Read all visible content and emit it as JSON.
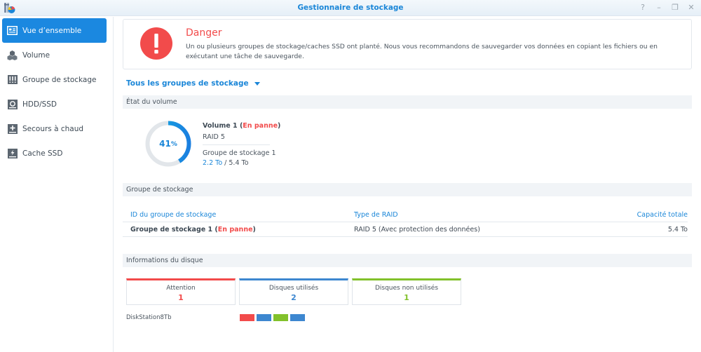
{
  "window": {
    "title": "Gestionnaire de stockage",
    "controls": [
      {
        "name": "help",
        "glyph": "?"
      },
      {
        "name": "minimize",
        "glyph": "–"
      },
      {
        "name": "restore",
        "glyph": "❐"
      },
      {
        "name": "close",
        "glyph": "✕"
      }
    ]
  },
  "sidebar": {
    "items": [
      {
        "label": "Vue d’ensemble",
        "icon": "overview-icon",
        "active": true
      },
      {
        "label": "Volume",
        "icon": "volume-icon",
        "active": false
      },
      {
        "label": "Groupe de stockage",
        "icon": "storage-pool-icon",
        "active": false
      },
      {
        "label": "HDD/SSD",
        "icon": "hdd-icon",
        "active": false
      },
      {
        "label": "Secours à chaud",
        "icon": "hot-spare-icon",
        "active": false
      },
      {
        "label": "Cache SSD",
        "icon": "ssd-cache-icon",
        "active": false
      }
    ]
  },
  "alert": {
    "title": "Danger",
    "message": "Un ou plusieurs groupes de stockage/caches SSD ont planté. Nous vous recommandons de sauvegarder vos données en copiant les fichiers ou en exécutant une tâche de sauvegarde."
  },
  "filter": {
    "selected": "Tous les groupes de stockage"
  },
  "volume_status": {
    "heading": "État du volume",
    "usage_percent": 41,
    "usage_label": "41",
    "percent_sign": "%",
    "name": "Volume 1",
    "status": "En panne",
    "raid": "RAID 5",
    "pool": "Groupe de stockage 1",
    "used": "2.2 To",
    "separator": " / ",
    "total": "5.4 To"
  },
  "storage_pool": {
    "heading": "Groupe de stockage",
    "columns": [
      "ID du groupe de stockage",
      "Type de RAID",
      "Capacité totale"
    ],
    "rows": [
      {
        "id": "Groupe de stockage 1",
        "status": "En panne",
        "raid": "RAID 5 (Avec protection des données)",
        "capacity": "5.4 To"
      }
    ]
  },
  "disk_info": {
    "heading": "Informations du disque",
    "cards": [
      {
        "label": "Attention",
        "value": "1",
        "color": "#f24b4b"
      },
      {
        "label": "Disques utilisés",
        "value": "2",
        "color": "#3d87d0"
      },
      {
        "label": "Disques non utilisés",
        "value": "1",
        "color": "#82c12b"
      }
    ],
    "device": "DiskStation8Tb",
    "slots": [
      {
        "state": "attention",
        "color": "#f24b4b"
      },
      {
        "state": "used",
        "color": "#3d87d0"
      },
      {
        "state": "unused",
        "color": "#82c12b"
      },
      {
        "state": "used",
        "color": "#3d87d0"
      }
    ]
  },
  "colors": {
    "accent": "#1b88e0",
    "danger": "#f24b4b",
    "success": "#82c12b"
  }
}
